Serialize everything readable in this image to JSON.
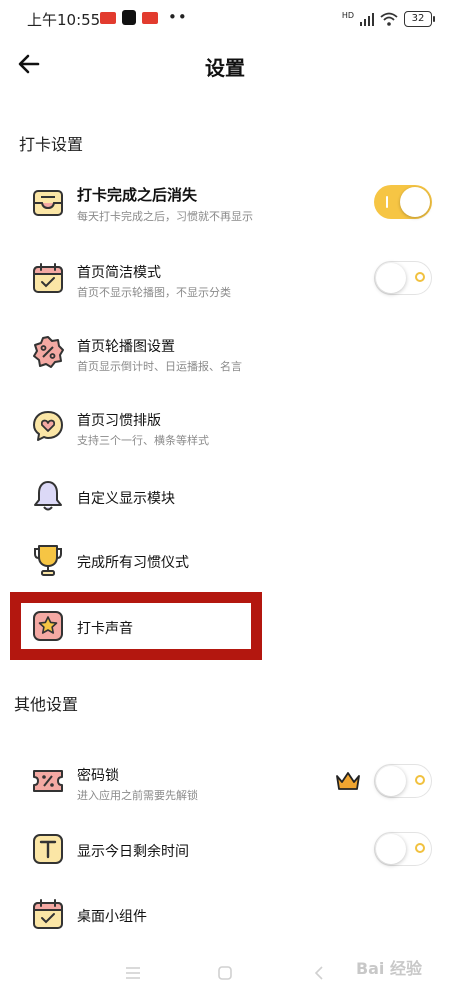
{
  "status_bar": {
    "time": "上午10:55",
    "dots": "••",
    "network": "HD",
    "battery": "32"
  },
  "header": {
    "title": "设置"
  },
  "section_checkin": {
    "title": "打卡设置"
  },
  "section_other": {
    "title": "其他设置"
  },
  "rows": [
    {
      "title": "打卡完成之后消失",
      "subtitle": "每天打卡完成之后，习惯就不再显示",
      "icon": "inbox-icon",
      "toggle": "on"
    },
    {
      "title": "首页简洁模式",
      "subtitle": "首页不显示轮播图，不显示分类",
      "icon": "calendar-check-icon",
      "toggle": "off"
    },
    {
      "title": "首页轮播图设置",
      "subtitle": "首页显示倒计时、日运播报、名言",
      "icon": "percent-badge-icon"
    },
    {
      "title": "首页习惯排版",
      "subtitle": "支持三个一行、横条等样式",
      "icon": "heart-chat-icon"
    },
    {
      "title": "自定义显示模块",
      "icon": "bell-icon"
    },
    {
      "title": "完成所有习惯仪式",
      "icon": "trophy-icon"
    },
    {
      "title": "打卡声音",
      "icon": "star-icon",
      "highlighted": true
    },
    {
      "title": "密码锁",
      "subtitle": "进入应用之前需要先解锁",
      "icon": "ticket-icon",
      "toggle": "off",
      "badge": "crown-icon"
    },
    {
      "title": "显示今日剩余时间",
      "icon": "text-t-icon",
      "toggle": "off"
    },
    {
      "title": "桌面小组件",
      "icon": "calendar-check-icon"
    }
  ],
  "watermark": {
    "text": "Bai 经验"
  },
  "colors": {
    "accent_yellow": "#f6c544",
    "icon_fill_yellow": "#fbe6a6",
    "icon_fill_pink": "#f4a9a3",
    "icon_stroke": "#333333",
    "highlight_red": "#b3170f"
  }
}
